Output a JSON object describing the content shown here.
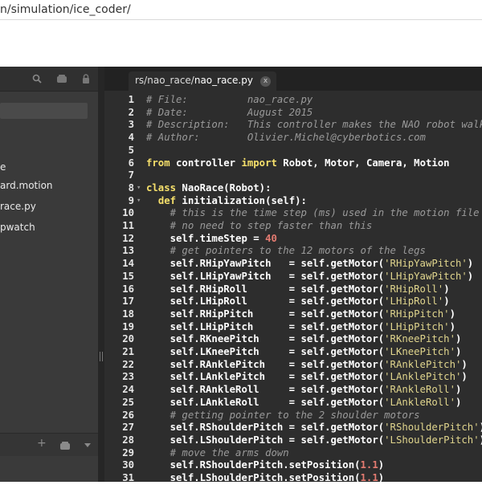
{
  "url": "n/simulation/ice_coder/",
  "sidebar": {
    "files": [
      {
        "label": "e"
      },
      {
        "label": "ard.motion"
      },
      {
        "label": "race.py"
      },
      {
        "label": "pwatch"
      }
    ],
    "bottom_icons": [
      "plus-icon",
      "folder-icon",
      "chevron-down-icon"
    ],
    "toolbar_icons": [
      "search-icon",
      "folder-icon",
      "lock-icon"
    ]
  },
  "tab": {
    "path_prefix": "rs/nao_race/",
    "filename": "nao_race.py",
    "close_label": "x"
  },
  "code": [
    {
      "n": "1",
      "seg": [
        [
          "c",
          "# File:          nao_race.py"
        ]
      ]
    },
    {
      "n": "2",
      "seg": [
        [
          "c",
          "# Date:          August 2015"
        ]
      ]
    },
    {
      "n": "3",
      "seg": [
        [
          "c",
          "# Description:   This controller makes the NAO robot walk a"
        ]
      ]
    },
    {
      "n": "4",
      "seg": [
        [
          "c",
          "# Author:        Olivier.Michel@cyberbotics.com"
        ]
      ]
    },
    {
      "n": "5",
      "seg": []
    },
    {
      "n": "6",
      "seg": [
        [
          "k",
          "from"
        ],
        [
          "t",
          " controller "
        ],
        [
          "k",
          "import"
        ],
        [
          "t",
          " Robot, Motor, Camera, Motion"
        ]
      ]
    },
    {
      "n": "7",
      "seg": []
    },
    {
      "n": "8",
      "fold": true,
      "seg": [
        [
          "k",
          "class"
        ],
        [
          "t",
          " NaoRace(Robot):"
        ]
      ]
    },
    {
      "n": "9",
      "fold": true,
      "seg": [
        [
          "t",
          "  "
        ],
        [
          "k",
          "def"
        ],
        [
          "t",
          " initialization(self):"
        ]
      ]
    },
    {
      "n": "10",
      "seg": [
        [
          "c",
          "    # this is the time step (ms) used in the motion file"
        ]
      ]
    },
    {
      "n": "11",
      "seg": [
        [
          "c",
          "    # no need to step faster than this"
        ]
      ]
    },
    {
      "n": "12",
      "seg": [
        [
          "t",
          "    self.timeStep = "
        ],
        [
          "n",
          "40"
        ]
      ]
    },
    {
      "n": "13",
      "seg": [
        [
          "c",
          "    # get pointers to the 12 motors of the legs"
        ]
      ]
    },
    {
      "n": "14",
      "seg": [
        [
          "t",
          "    self.RHipYawPitch   = self.getMotor("
        ],
        [
          "s",
          "'RHipYawPitch'"
        ],
        [
          "t",
          ")"
        ]
      ]
    },
    {
      "n": "15",
      "seg": [
        [
          "t",
          "    self.LHipYawPitch   = self.getMotor("
        ],
        [
          "s",
          "'LHipYawPitch'"
        ],
        [
          "t",
          ")"
        ]
      ]
    },
    {
      "n": "16",
      "seg": [
        [
          "t",
          "    self.RHipRoll       = self.getMotor("
        ],
        [
          "s",
          "'RHipRoll'"
        ],
        [
          "t",
          ")"
        ]
      ]
    },
    {
      "n": "17",
      "seg": [
        [
          "t",
          "    self.LHipRoll       = self.getMotor("
        ],
        [
          "s",
          "'LHipRoll'"
        ],
        [
          "t",
          ")"
        ]
      ]
    },
    {
      "n": "18",
      "seg": [
        [
          "t",
          "    self.RHipPitch      = self.getMotor("
        ],
        [
          "s",
          "'RHipPitch'"
        ],
        [
          "t",
          ")"
        ]
      ]
    },
    {
      "n": "19",
      "seg": [
        [
          "t",
          "    self.LHipPitch      = self.getMotor("
        ],
        [
          "s",
          "'LHipPitch'"
        ],
        [
          "t",
          ")"
        ]
      ]
    },
    {
      "n": "20",
      "seg": [
        [
          "t",
          "    self.RKneePitch     = self.getMotor("
        ],
        [
          "s",
          "'RKneePitch'"
        ],
        [
          "t",
          ")"
        ]
      ]
    },
    {
      "n": "21",
      "seg": [
        [
          "t",
          "    self.LKneePitch     = self.getMotor("
        ],
        [
          "s",
          "'LKneePitch'"
        ],
        [
          "t",
          ")"
        ]
      ]
    },
    {
      "n": "22",
      "seg": [
        [
          "t",
          "    self.RAnklePitch    = self.getMotor("
        ],
        [
          "s",
          "'RAnklePitch'"
        ],
        [
          "t",
          ")"
        ]
      ]
    },
    {
      "n": "23",
      "seg": [
        [
          "t",
          "    self.LAnklePitch    = self.getMotor("
        ],
        [
          "s",
          "'LAnklePitch'"
        ],
        [
          "t",
          ")"
        ]
      ]
    },
    {
      "n": "24",
      "seg": [
        [
          "t",
          "    self.RAnkleRoll     = self.getMotor("
        ],
        [
          "s",
          "'RAnkleRoll'"
        ],
        [
          "t",
          ")"
        ]
      ]
    },
    {
      "n": "25",
      "seg": [
        [
          "t",
          "    self.LAnkleRoll     = self.getMotor("
        ],
        [
          "s",
          "'LAnkleRoll'"
        ],
        [
          "t",
          ")"
        ]
      ]
    },
    {
      "n": "26",
      "seg": [
        [
          "c",
          "    # getting pointer to the 2 shoulder motors"
        ]
      ]
    },
    {
      "n": "27",
      "seg": [
        [
          "t",
          "    self.RShoulderPitch = self.getMotor("
        ],
        [
          "s",
          "'RShoulderPitch'"
        ],
        [
          "t",
          ")"
        ]
      ]
    },
    {
      "n": "28",
      "seg": [
        [
          "t",
          "    self.LShoulderPitch = self.getMotor("
        ],
        [
          "s",
          "'LShoulderPitch'"
        ],
        [
          "t",
          ")"
        ]
      ]
    },
    {
      "n": "29",
      "seg": [
        [
          "c",
          "    # move the arms down"
        ]
      ]
    },
    {
      "n": "30",
      "seg": [
        [
          "t",
          "    self.RShoulderPitch.setPosition("
        ],
        [
          "n",
          "1.1"
        ],
        [
          "t",
          ")"
        ]
      ]
    },
    {
      "n": "31",
      "seg": [
        [
          "t",
          "    self.LShoulderPitch.setPosition("
        ],
        [
          "n",
          "1.1"
        ],
        [
          "t",
          ")"
        ]
      ]
    }
  ]
}
